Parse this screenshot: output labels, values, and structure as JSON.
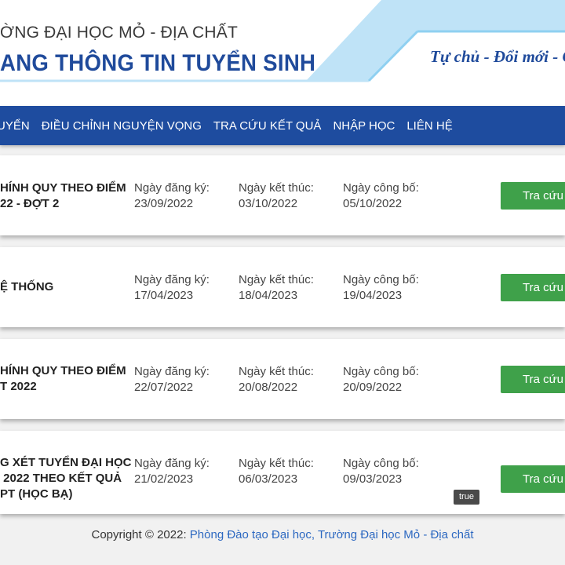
{
  "header": {
    "school_name": "ỜNG ĐẠI HỌC MỎ - ĐỊA CHẤT",
    "portal_name": "ANG THÔNG TIN TUYỂN SINH",
    "slogan": "Tự chủ - Đổi mới - C",
    "colors": {
      "primary_blue": "#1f4a9b",
      "light_blue": "#bfe3f7"
    }
  },
  "nav": {
    "items": [
      {
        "label": "UYỂN"
      },
      {
        "label": "ĐIỀU CHỈNH NGUYỆN VỌNG"
      },
      {
        "label": "TRA CỨU KẾT QUẢ"
      },
      {
        "label": "NHẬP HỌC"
      },
      {
        "label": "LIÊN HỆ"
      }
    ],
    "color": "#1e4c9f"
  },
  "cards": [
    {
      "title": "HÍNH QUY THEO ĐIỂM\n22 - ĐỢT 2",
      "reg_label": "Ngày đăng ký:",
      "reg_date": "23/09/2022",
      "end_label": "Ngày kết thúc:",
      "end_date": "03/10/2022",
      "pub_label": "Ngày công bố:",
      "pub_date": "05/10/2022",
      "button": "Tra cứu k"
    },
    {
      "title": "Ệ THỐNG",
      "reg_label": "Ngày đăng ký:",
      "reg_date": "17/04/2023",
      "end_label": "Ngày kết thúc:",
      "end_date": "18/04/2023",
      "pub_label": "Ngày công bố:",
      "pub_date": "19/04/2023",
      "button": "Tra cứu k"
    },
    {
      "title": "HÍNH QUY THEO ĐIỂM\nT 2022",
      "reg_label": "Ngày đăng ký:",
      "reg_date": "22/07/2022",
      "end_label": "Ngày kết thúc:",
      "end_date": "20/08/2022",
      "pub_label": "Ngày công bố:",
      "pub_date": "20/09/2022",
      "button": "Tra cứu k"
    },
    {
      "title": "G XÉT TUYỂN ĐẠI HỌC\n 2022 THEO KẾT QUẢ\nPT (HỌC BẠ)",
      "reg_label": "Ngày đăng ký:",
      "reg_date": "21/02/2023",
      "end_label": "Ngày kết thúc:",
      "end_date": "06/03/2023",
      "pub_label": "Ngày công bố:",
      "pub_date": "09/03/2023",
      "button": "Tra cứu k"
    }
  ],
  "button_color": "#3fa14a",
  "tooltip": "true",
  "footer": {
    "prefix": "Copyright © 2022: ",
    "link": "Phòng Đào tạo Đại học, Trường Đại học Mỏ - Địa chất"
  }
}
